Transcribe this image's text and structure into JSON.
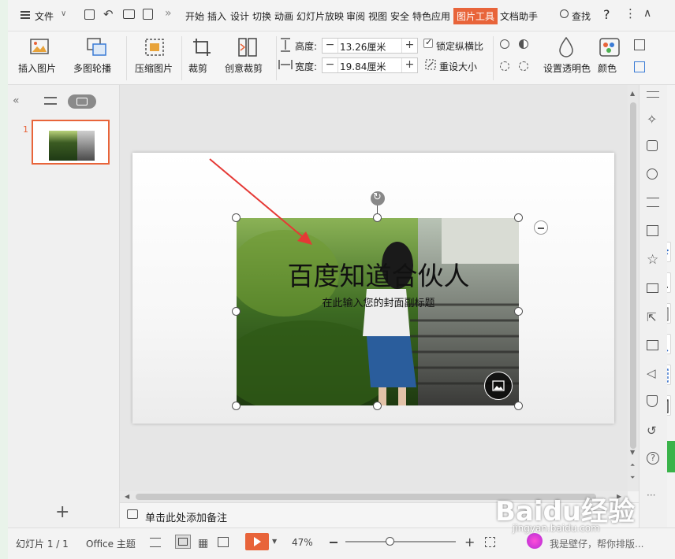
{
  "menubar": {
    "file_label": "文件",
    "tabs": [
      "开始",
      "插入",
      "设计",
      "切换",
      "动画",
      "幻灯片放映",
      "审阅",
      "视图",
      "安全",
      "特色应用",
      "图片工具",
      "文档助手"
    ],
    "active_tab": "图片工具",
    "search_label": "查找",
    "help_label": "?"
  },
  "ribbon": {
    "insert_picture": "插入图片",
    "multi_carousel": "多图轮播",
    "compress_picture": "压缩图片",
    "crop": "裁剪",
    "creative_crop": "创意裁剪",
    "height_label": "高度:",
    "height_value": "13.26厘米",
    "width_label": "宽度:",
    "width_value": "19.84厘米",
    "lock_ratio": "锁定纵横比",
    "lock_ratio_checked": true,
    "reset_size": "重设大小",
    "set_transparent": "设置透明色",
    "color": "颜色"
  },
  "left_pane": {
    "slide_number": "1"
  },
  "slide": {
    "title": "百度知道合伙人",
    "subtitle": "在此输入您的封面副标题"
  },
  "notes": {
    "placeholder": "单击此处添加备注"
  },
  "status": {
    "slide_info": "幻灯片 1 / 1",
    "theme": "Office 主题",
    "zoom": "47%",
    "zoom_fraction": 0.4,
    "watermark_text": "Baidu经验",
    "watermark_url": "jingyan.baidu.com",
    "promo": "我是壁仔，帮你排版..."
  },
  "colors": {
    "accent": "#e8643a",
    "play": "#e8643a",
    "annotation_arrow": "#e53935"
  }
}
